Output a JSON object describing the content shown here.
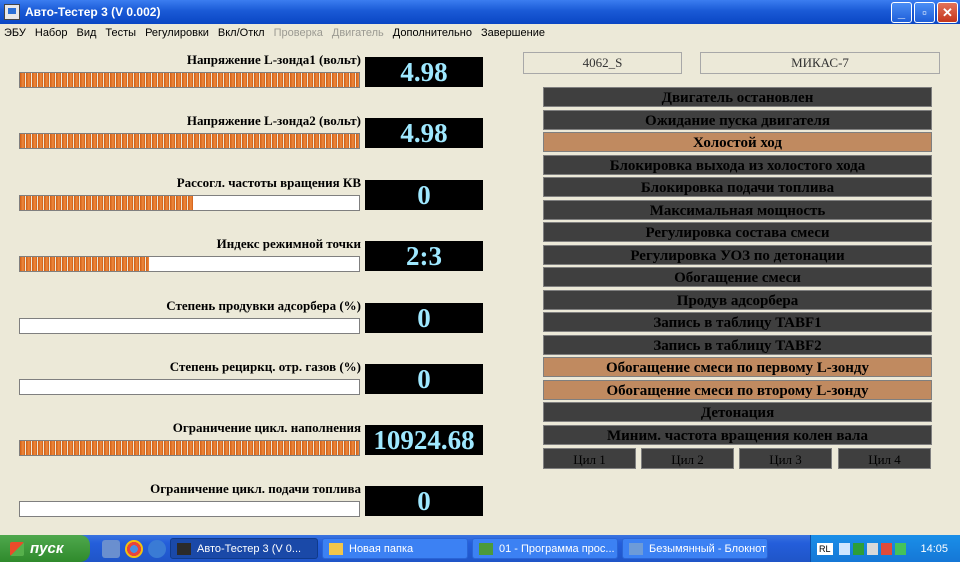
{
  "window": {
    "title": "Авто-Тестер 3  (V 0.002)",
    "buttons": {
      "minimize": "_",
      "maximize": "▫",
      "close": "✕"
    }
  },
  "menu": [
    {
      "label": "ЭБУ",
      "enabled": true
    },
    {
      "label": "Набор",
      "enabled": true
    },
    {
      "label": "Вид",
      "enabled": true
    },
    {
      "label": "Тесты",
      "enabled": true
    },
    {
      "label": "Регулировки",
      "enabled": true
    },
    {
      "label": "Вкл/Откл",
      "enabled": true
    },
    {
      "label": "Проверка",
      "enabled": false
    },
    {
      "label": "Двигатель",
      "enabled": false
    },
    {
      "label": "Дополнительно",
      "enabled": true
    },
    {
      "label": "Завершение",
      "enabled": true
    }
  ],
  "gauges": [
    {
      "label": "Напряжение L-зонда1 (вольт)",
      "value": "4.98",
      "fill": 1.0
    },
    {
      "label": "Напряжение L-зонда2 (вольт)",
      "value": "4.98",
      "fill": 1.0
    },
    {
      "label": "Рассогл. частоты вращения КВ",
      "value": "0",
      "fill": 0.51
    },
    {
      "label": "Индекс режимной точки",
      "value": "2:3",
      "fill": 0.38
    },
    {
      "label": "Степень продувки адсорбера (%)",
      "value": "0",
      "fill": 0
    },
    {
      "label": "Степень рециркц. отр. газов (%)",
      "value": "0",
      "fill": 0
    },
    {
      "label": "Ограничение цикл. наполнения",
      "value": "10924.68",
      "fill": 1.0
    },
    {
      "label": "Ограничение цикл. подачи топлива",
      "value": "0",
      "fill": 0
    }
  ],
  "info": {
    "firmware": "4062_S",
    "ecu": "МИКАС-7"
  },
  "modes": [
    {
      "label": "Двигатель остановлен",
      "active": false
    },
    {
      "label": "Ожидание пуска двигателя",
      "active": false
    },
    {
      "label": "Холостой ход",
      "active": true
    },
    {
      "label": "Блокировка выхода из холостого хода",
      "active": false
    },
    {
      "label": "Блокировка подачи топлива",
      "active": false
    },
    {
      "label": "Максимальная мощность",
      "active": false
    },
    {
      "label": "Регулировка состава смеси",
      "active": false
    },
    {
      "label": "Регулировка УОЗ по детонации",
      "active": false
    },
    {
      "label": "Обогащение смеси",
      "active": false
    },
    {
      "label": "Продув адсорбера",
      "active": false
    },
    {
      "label": "Запись в таблицу TABF1",
      "active": false
    },
    {
      "label": "Запись в таблицу TABF2",
      "active": false
    },
    {
      "label": "Обогащение смеси по первому L-зонду",
      "active": true
    },
    {
      "label": "Обогащение смеси по второму L-зонду",
      "active": true
    },
    {
      "label": "Детонация",
      "active": false
    },
    {
      "label": "Миним. частота вращения колен вала",
      "active": false
    }
  ],
  "cylinders": [
    "Цил 1",
    "Цил 2",
    "Цил 3",
    "Цил 4"
  ],
  "colors": {
    "active_mode": "#c08a60",
    "inactive_mode": "#3f3f3f",
    "readout_text": "#9fe8ff",
    "bar": "#cf5c14"
  },
  "taskbar": {
    "start_label": "пуск",
    "tasks": [
      {
        "label": "Авто-Тестер 3  (V 0...",
        "active": true
      },
      {
        "label": "Новая папка",
        "active": false
      },
      {
        "label": "01 - Программа прос...",
        "active": false
      },
      {
        "label": "Безымянный - Блокнот",
        "active": false
      }
    ],
    "lang": "RL",
    "clock": "14:05"
  }
}
